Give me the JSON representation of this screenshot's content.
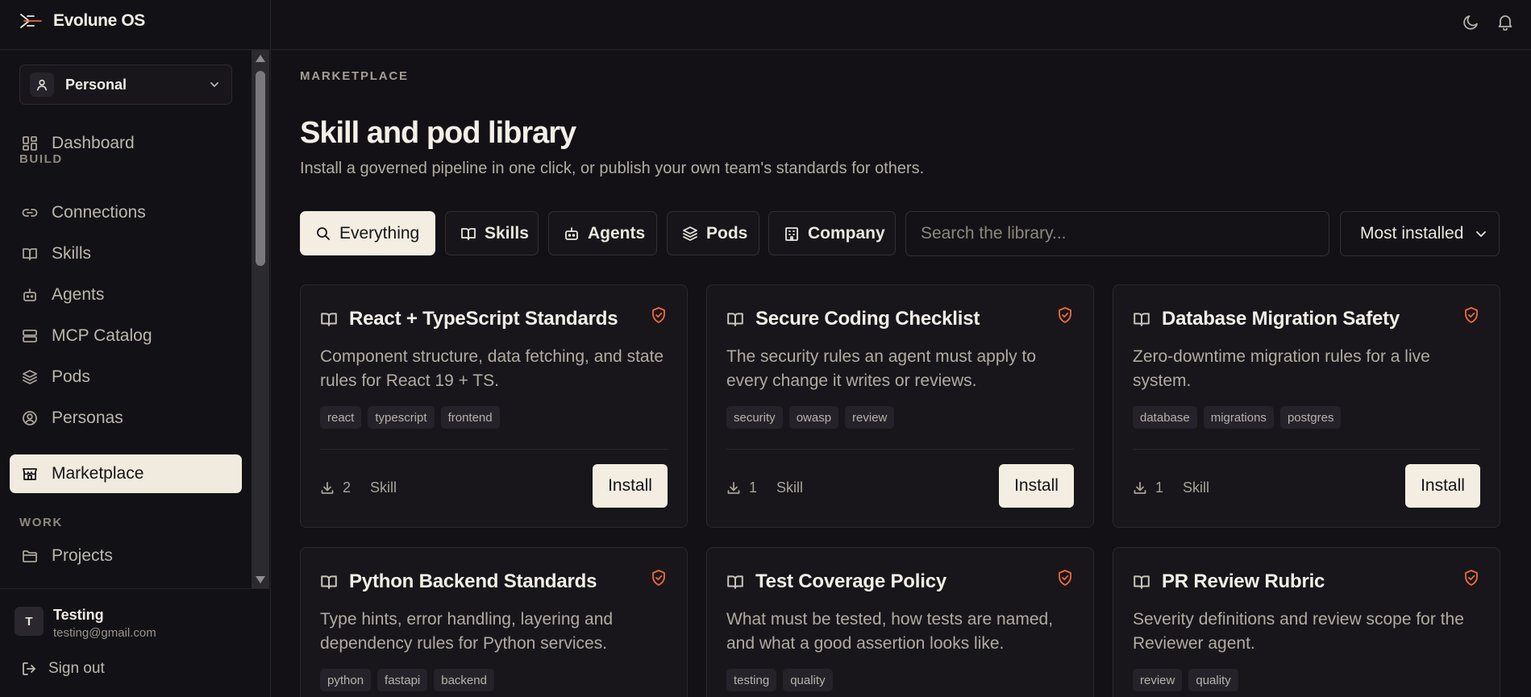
{
  "app": {
    "name": "Evolune OS"
  },
  "workspace": {
    "label": "Personal"
  },
  "sidebar": {
    "items": [
      {
        "label": "Dashboard",
        "icon": "dashboard-icon"
      },
      {
        "label": "Connections",
        "icon": "link-icon"
      },
      {
        "label": "Skills",
        "icon": "book-icon"
      },
      {
        "label": "Agents",
        "icon": "bot-icon"
      },
      {
        "label": "MCP Catalog",
        "icon": "server-icon"
      },
      {
        "label": "Pods",
        "icon": "layers-icon"
      },
      {
        "label": "Personas",
        "icon": "user-circle-icon"
      },
      {
        "label": "Marketplace",
        "icon": "store-icon",
        "active": true
      },
      {
        "label": "Projects",
        "icon": "folder-icon"
      }
    ],
    "sections": {
      "build": "BUILD",
      "work": "WORK"
    }
  },
  "user": {
    "initial": "T",
    "name": "Testing",
    "email": "testing@gmail.com",
    "signout_label": "Sign out"
  },
  "page": {
    "eyebrow": "MARKETPLACE",
    "title": "Skill and pod library",
    "subtitle": "Install a governed pipeline in one click, or publish your own team's standards for others."
  },
  "filters": [
    {
      "label": "Everything",
      "icon": "search-icon",
      "active": true
    },
    {
      "label": "Skills",
      "icon": "book-icon"
    },
    {
      "label": "Agents",
      "icon": "bot-icon"
    },
    {
      "label": "Pods",
      "icon": "layers-icon"
    },
    {
      "label": "Company",
      "icon": "building-icon"
    }
  ],
  "search": {
    "placeholder": "Search the library...",
    "value": ""
  },
  "sort": {
    "selected": "Most installed"
  },
  "cards": [
    {
      "title": "React + TypeScript Standards",
      "description": "Component structure, data fetching, and state rules for React 19 + TS.",
      "tags": [
        "react",
        "typescript",
        "frontend"
      ],
      "installs": "2",
      "kind": "Skill",
      "install_label": "Install"
    },
    {
      "title": "Secure Coding Checklist",
      "description": "The security rules an agent must apply to every change it writes or reviews.",
      "tags": [
        "security",
        "owasp",
        "review"
      ],
      "installs": "1",
      "kind": "Skill",
      "install_label": "Install"
    },
    {
      "title": "Database Migration Safety",
      "description": "Zero-downtime migration rules for a live system.",
      "tags": [
        "database",
        "migrations",
        "postgres"
      ],
      "installs": "1",
      "kind": "Skill",
      "install_label": "Install"
    },
    {
      "title": "Python Backend Standards",
      "description": "Type hints, error handling, layering and dependency rules for Python services.",
      "tags": [
        "python",
        "fastapi",
        "backend"
      ],
      "installs": "",
      "kind": "",
      "install_label": ""
    },
    {
      "title": "Test Coverage Policy",
      "description": "What must be tested, how tests are named, and what a good assertion looks like.",
      "tags": [
        "testing",
        "quality"
      ],
      "installs": "",
      "kind": "",
      "install_label": ""
    },
    {
      "title": "PR Review Rubric",
      "description": "Severity definitions and review scope for the Reviewer agent.",
      "tags": [
        "review",
        "quality"
      ],
      "installs": "",
      "kind": "",
      "install_label": ""
    }
  ],
  "colors": {
    "accent": "#f3ede2",
    "badge": "#ee6a3c",
    "background": "#131115"
  }
}
